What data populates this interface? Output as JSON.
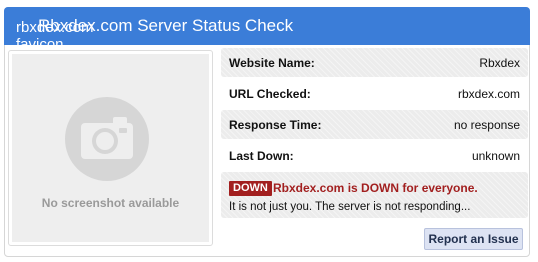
{
  "header": {
    "favicon_alt": "rbxdex.com favicon",
    "title": "Rbxdex.com Server Status Check",
    "accent_color": "#3b7dd8"
  },
  "screenshot": {
    "placeholder_icon": "camera-icon",
    "caption": "No screenshot available"
  },
  "details": [
    {
      "label": "Website Name:",
      "value": "Rbxdex"
    },
    {
      "label": "URL Checked:",
      "value": "rbxdex.com"
    },
    {
      "label": "Response Time:",
      "value": "no response"
    },
    {
      "label": "Last Down:",
      "value": "unknown"
    }
  ],
  "status": {
    "badge": "DOWN",
    "headline": "Rbxdex.com is DOWN for everyone.",
    "message": "It is not just you. The server is not responding...",
    "color": "#a21f1f"
  },
  "actions": {
    "report_label": "Report an Issue"
  }
}
